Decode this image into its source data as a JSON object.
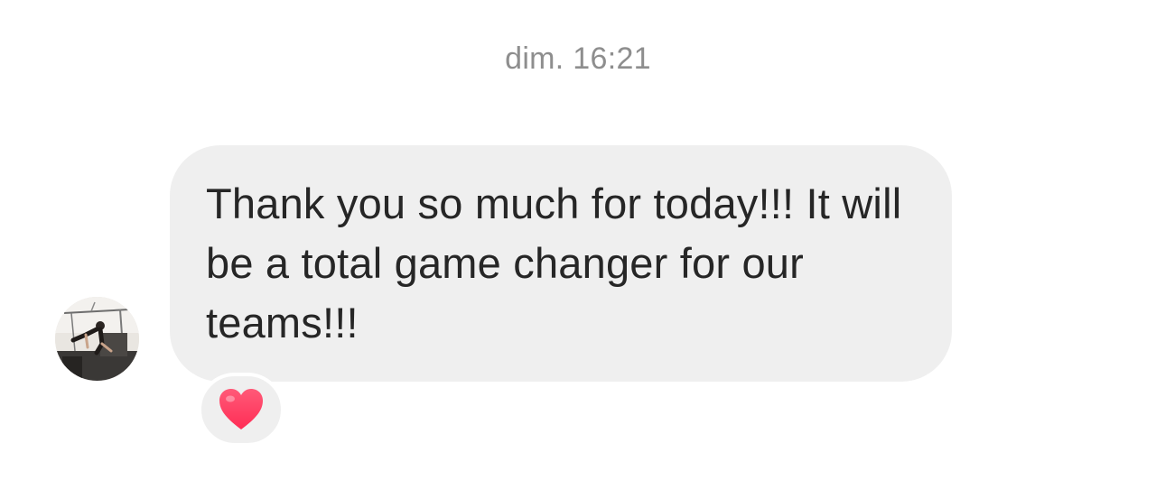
{
  "conversation": {
    "timestamp": "dim. 16:21",
    "message": {
      "text": "Thank you so much for today!!! It will be a total game changer for our teams!!!",
      "reaction": {
        "icon": "heart-icon",
        "color": "#ff3b5c"
      }
    },
    "colors": {
      "bubble": "#efefef",
      "text": "#262626",
      "timestamp": "#8e8e8e"
    }
  }
}
